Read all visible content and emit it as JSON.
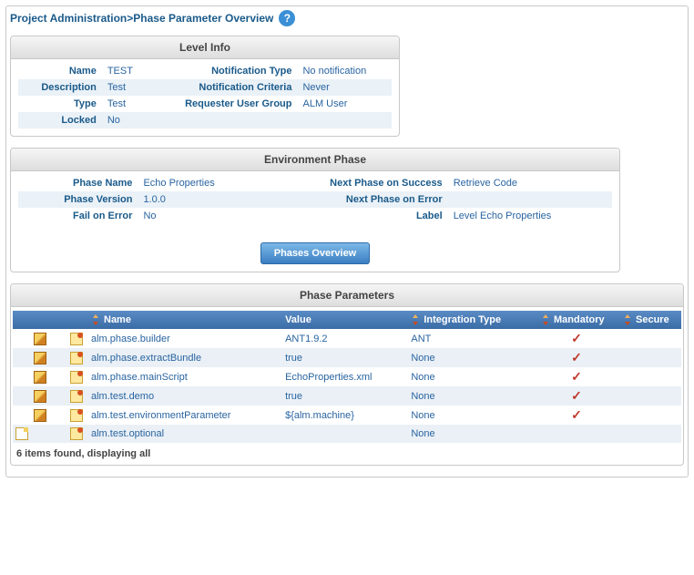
{
  "breadcrumb": {
    "part1": "Project Administration",
    "sep": ">",
    "part2": "Phase Parameter Overview"
  },
  "levelInfo": {
    "title": "Level Info",
    "rows": [
      {
        "l1": "Name",
        "v1": "TEST",
        "l2": "Notification Type",
        "v2": "No notification"
      },
      {
        "l1": "Description",
        "v1": "Test",
        "l2": "Notification Criteria",
        "v2": "Never"
      },
      {
        "l1": "Type",
        "v1": "Test",
        "l2": "Requester User Group",
        "v2": "ALM User"
      },
      {
        "l1": "Locked",
        "v1": "No",
        "l2": "",
        "v2": ""
      }
    ]
  },
  "envPhase": {
    "title": "Environment Phase",
    "rows": [
      {
        "l1": "Phase Name",
        "v1": "Echo Properties",
        "l2": "Next Phase on Success",
        "v2": "Retrieve Code"
      },
      {
        "l1": "Phase Version",
        "v1": "1.0.0",
        "l2": "Next Phase on Error",
        "v2": ""
      },
      {
        "l1": "Fail on Error",
        "v1": "No",
        "l2": "Label",
        "v2": "Level Echo Properties"
      }
    ],
    "button": "Phases Overview"
  },
  "phaseParams": {
    "title": "Phase Parameters",
    "headers": {
      "name": "Name",
      "value": "Value",
      "integration": "Integration Type",
      "mandatory": "Mandatory",
      "secure": "Secure"
    },
    "rows": [
      {
        "name": "alm.phase.builder",
        "value": "ANT1.9.2",
        "integration": "ANT",
        "mandatory": true,
        "secure": false,
        "editable": true,
        "hasNote": false
      },
      {
        "name": "alm.phase.extractBundle",
        "value": "true",
        "integration": "None",
        "mandatory": true,
        "secure": false,
        "editable": true,
        "hasNote": false
      },
      {
        "name": "alm.phase.mainScript",
        "value": "EchoProperties.xml",
        "integration": "None",
        "mandatory": true,
        "secure": false,
        "editable": true,
        "hasNote": false
      },
      {
        "name": "alm.test.demo",
        "value": "true",
        "integration": "None",
        "mandatory": true,
        "secure": false,
        "editable": true,
        "hasNote": false
      },
      {
        "name": "alm.test.environmentParameter",
        "value": "${alm.machine}",
        "integration": "None",
        "mandatory": true,
        "secure": false,
        "editable": true,
        "hasNote": false
      },
      {
        "name": "alm.test.optional",
        "value": "",
        "integration": "None",
        "mandatory": false,
        "secure": false,
        "editable": false,
        "hasNote": true
      }
    ],
    "footer": "6 items found, displaying all"
  }
}
